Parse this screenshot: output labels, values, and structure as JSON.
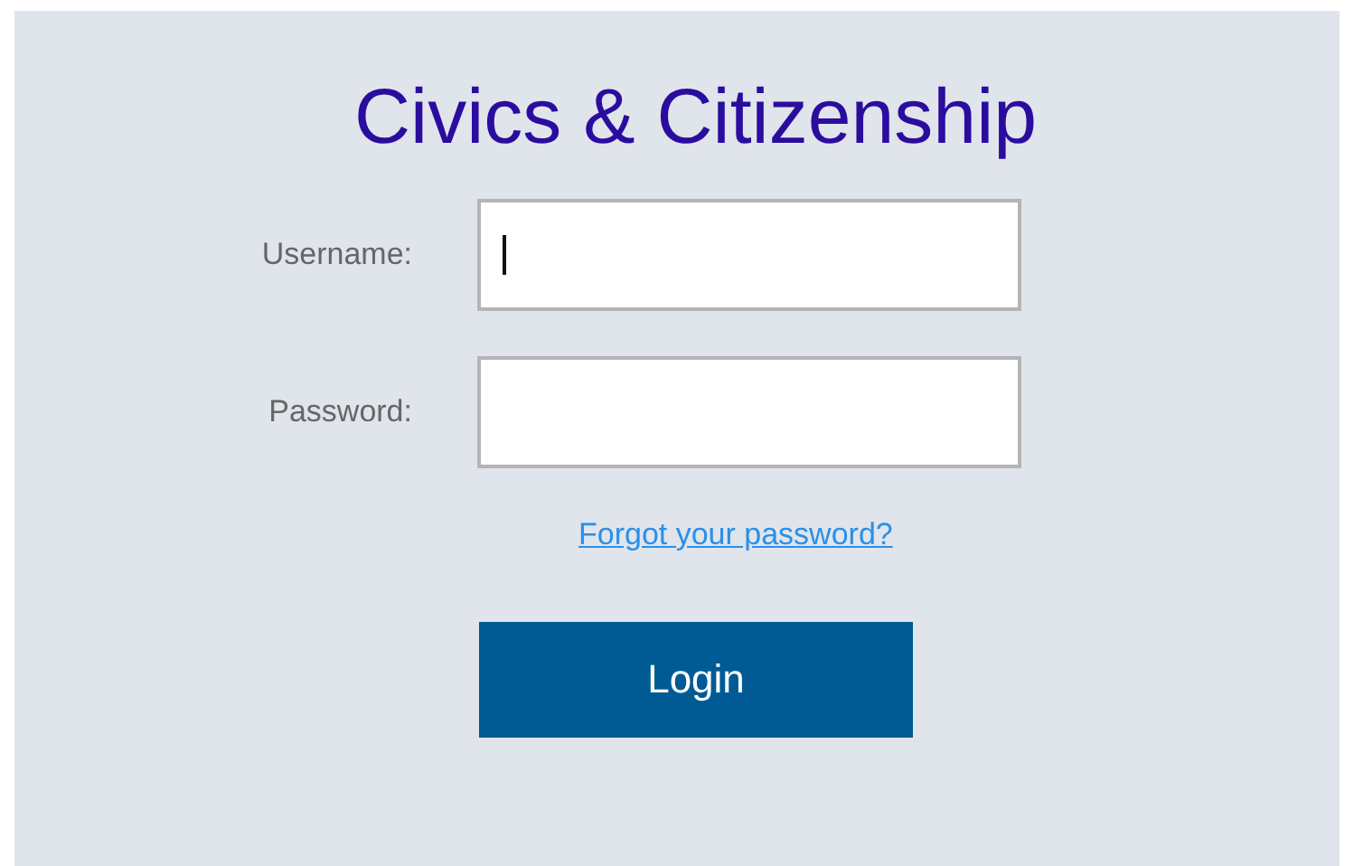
{
  "title": "Civics & Citizenship",
  "fields": [
    {
      "label": "Username:",
      "focused": true
    },
    {
      "label": "Password:",
      "focused": false
    }
  ],
  "forgot_link": "Forgot your password?",
  "login_button": "Login"
}
